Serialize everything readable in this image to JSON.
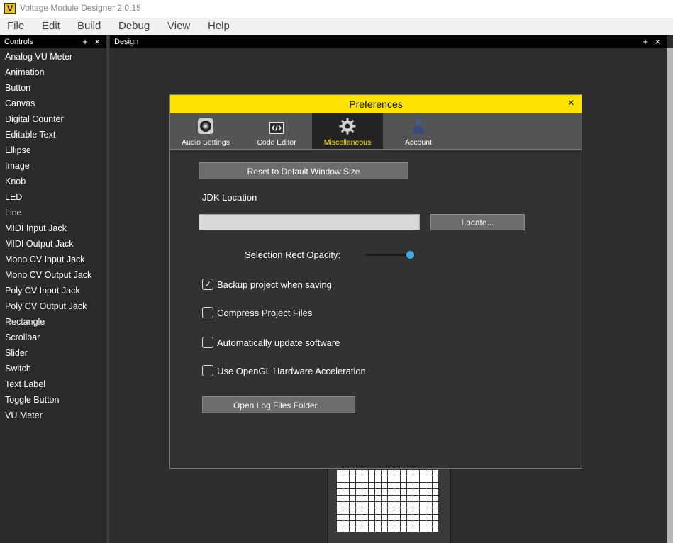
{
  "window": {
    "title": "Voltage Module Designer 2.0.15",
    "logo": "V"
  },
  "menu": [
    "File",
    "Edit",
    "Build",
    "Debug",
    "View",
    "Help"
  ],
  "controls_panel": {
    "title": "Controls",
    "controls": "+ ×",
    "items": [
      "Analog VU Meter",
      "Animation",
      "Button",
      "Canvas",
      "Digital Counter",
      "Editable Text",
      "Ellipse",
      "Image",
      "Knob",
      "LED",
      "Line",
      "MIDI Input Jack",
      "MIDI Output Jack",
      "Mono CV Input Jack",
      "Mono CV Output Jack",
      "Poly CV Input Jack",
      "Poly CV Output Jack",
      "Rectangle",
      "Scrollbar",
      "Slider",
      "Switch",
      "Text Label",
      "Toggle Button",
      "VU Meter"
    ]
  },
  "design_panel": {
    "title": "Design",
    "controls": "+ ×"
  },
  "dialog": {
    "title": "Preferences",
    "close": "×",
    "accent": "#fde200",
    "tabs": [
      {
        "label": "Audio Settings",
        "icon": "speaker-icon"
      },
      {
        "label": "Code Editor",
        "icon": "code-editor-icon"
      },
      {
        "label": "Miscellaneous",
        "icon": "gear-icon",
        "active": true
      },
      {
        "label": "Account",
        "icon": "user-icon"
      }
    ],
    "reset_button": "Reset to Default Window Size",
    "jdk_label": "JDK Location",
    "jdk_value": "",
    "locate_button": "Locate...",
    "opacity_label": "Selection Rect Opacity:",
    "opacity_value": 0.9,
    "checkboxes": [
      {
        "label": "Backup project when saving",
        "checked": true,
        "mark": "✓"
      },
      {
        "label": "Compress Project Files",
        "checked": false
      },
      {
        "label": "Automatically update software",
        "checked": false
      },
      {
        "label": "Use OpenGL Hardware Acceleration",
        "checked": false
      }
    ],
    "log_button": "Open Log Files Folder..."
  }
}
